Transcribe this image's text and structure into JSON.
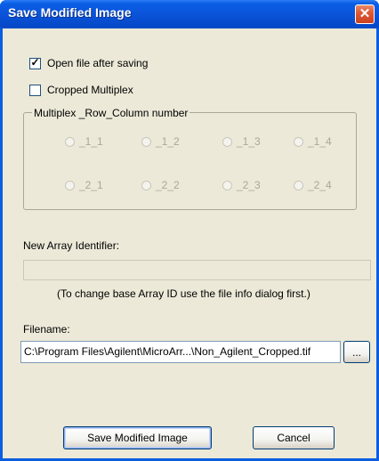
{
  "window": {
    "title": "Save Modified Image",
    "close_glyph": "✕",
    "accent_color": "#0a52d8"
  },
  "options": {
    "open_after_saving": {
      "label": "Open file after saving",
      "checked": true
    },
    "cropped_multiplex": {
      "label": "Cropped Multiplex",
      "checked": false
    }
  },
  "multiplex_group": {
    "legend": "Multiplex _Row_Column number",
    "radios": [
      "_1_1",
      "_1_2",
      "_1_3",
      "_1_4",
      "_2_1",
      "_2_2",
      "_2_3",
      "_2_4"
    ]
  },
  "array_identifier": {
    "label": "New Array Identifier:",
    "value": "",
    "hint": "(To change base Array ID use the file info dialog first.)"
  },
  "filename": {
    "label": "Filename:",
    "value": "C:\\Program Files\\Agilent\\MicroArr...\\Non_Agilent_Cropped.tif",
    "browse_label": "..."
  },
  "buttons": {
    "save_label": "Save Modified Image",
    "cancel_label": "Cancel"
  }
}
